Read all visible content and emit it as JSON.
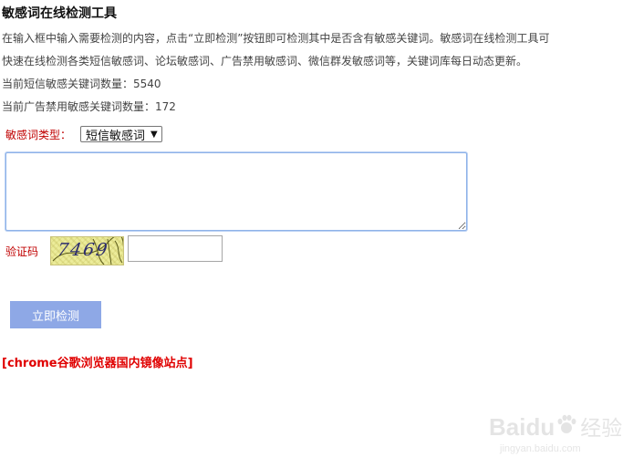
{
  "page": {
    "title": "敏感词在线检测工具",
    "description_lines": [
      "在输入框中输入需要检测的内容，点击“立即检测”按钮即可检测其中是否含有敏感关键词。敏感词在线检测工具可",
      "快速在线检测各类短信敏感词、论坛敏感词、广告禁用敏感词、微信群发敏感词等，关键词库每日动态更新。"
    ],
    "counts": {
      "sms_line": "当前短信敏感关键词数量：5540",
      "ad_line": "当前广告禁用敏感关键词数量：172"
    }
  },
  "form": {
    "type_label": "敏感词类型：",
    "type_selected": "短信敏感词",
    "type_chevron_icon": "chevron-down-icon",
    "content_value": "",
    "captcha_label": "验证码",
    "captcha_text": "7469",
    "captcha_value": "",
    "submit_label": "立即检测"
  },
  "links": {
    "mirror": "[chrome谷歌浏览器国内镜像站点]"
  },
  "watermark": {
    "brand": "Baidu",
    "sub": "经验",
    "url": "jingyan.baidu.com",
    "icon": "paw-icon"
  },
  "colors": {
    "label_red": "#c00000",
    "link_red": "#e00000",
    "button_bg": "#8ea8e6",
    "textarea_focus": "#8fb3e8",
    "captcha_bg": "#ecec9a"
  }
}
